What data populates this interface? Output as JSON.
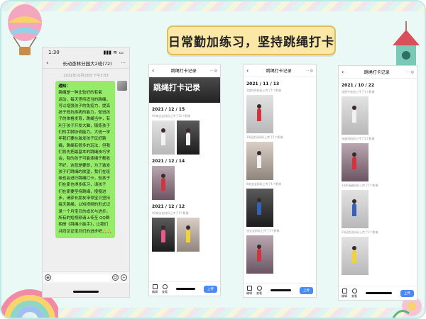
{
  "banner": {
    "title": "日常勤加练习，坚持跳绳打卡"
  },
  "phone1": {
    "time": "1:30",
    "signal": "▮▮▮ ≋ ▭",
    "chat_title": "长动杏林分园大2班(72)",
    "timestamp": "2021年10月18日 下午3:03",
    "lines": [
      "通知：",
      "跳绳是一种比较好的有氧",
      "运动，每天坚持适当的跳绳，",
      "可以增强孩子的免疫力，提高",
      "孩子抵抗疾病的能力，促进孩",
      "子的体格发育，跳绳当中，有",
      "利于孩子开发大脑，锻炼孩子",
      "们的手脚协调能力。大班一学",
      "年我们要在激发孩子玩好跳",
      "绳，跳绳有很多的玩法，但我",
      "们将先把最基本的跳绳技巧学",
      "会，有的孩子可能连绳子都收",
      "不好，这就是要即，为了激发",
      "孩子们跳绳的欲望，我们在班",
      "级也会进行跳绳打卡，但孩子",
      "们在家也得多练习，请孩子",
      "们在家要坚持跳绳，慢慢进",
      "步，请家长朋友带领宝贝坚持",
      "每天跳绳，以短视频的形式记",
      "录一个月宝贝的成长与进步。",
      "所有的短视频请上传至 QQ群",
      "相册《跳绳小能手》，让我们",
      "共同见证宝贝们的进步吧🙏🙏"
    ]
  },
  "phone2": {
    "header": "跳绳打卡记录",
    "cover": "跳绳打卡记录",
    "entries": [
      {
        "date": "2021 / 12 / 15",
        "meta": "90来宝宝妈妈上传了11个影像"
      },
      {
        "date": "2021 / 12 / 14",
        "meta": ""
      },
      {
        "date": "2021 / 12 / 12",
        "meta": "90来宝宝妈妈上传了7个影像"
      }
    ],
    "tool1": "编辑",
    "tool2": "查看",
    "upload": "上传"
  },
  "phone3": {
    "header": "跳绳打卡记录",
    "date": "2021 / 11 / 13",
    "metas": [
      "2度特评妈妈上传了1个影像",
      "39班优班妈妈上传了1个影像",
      "8来宝宝妈妈上传了1个影像",
      "张宝宝妈妈上传了1个影像"
    ],
    "tool1": "编辑",
    "tool2": "查看",
    "upload": "上传"
  },
  "phone4": {
    "header": "跳绳打卡记录",
    "date": "2021 / 10 / 22",
    "metas": [
      "张智宇爸爸上传了1个影像",
      "张越涛妈妈上传了1个影像",
      "18杯请越妈妈上传了1个影像",
      "29班优班妈妈上传了1个影像"
    ],
    "tool1": "编辑",
    "tool2": "查看",
    "upload": "上传"
  }
}
